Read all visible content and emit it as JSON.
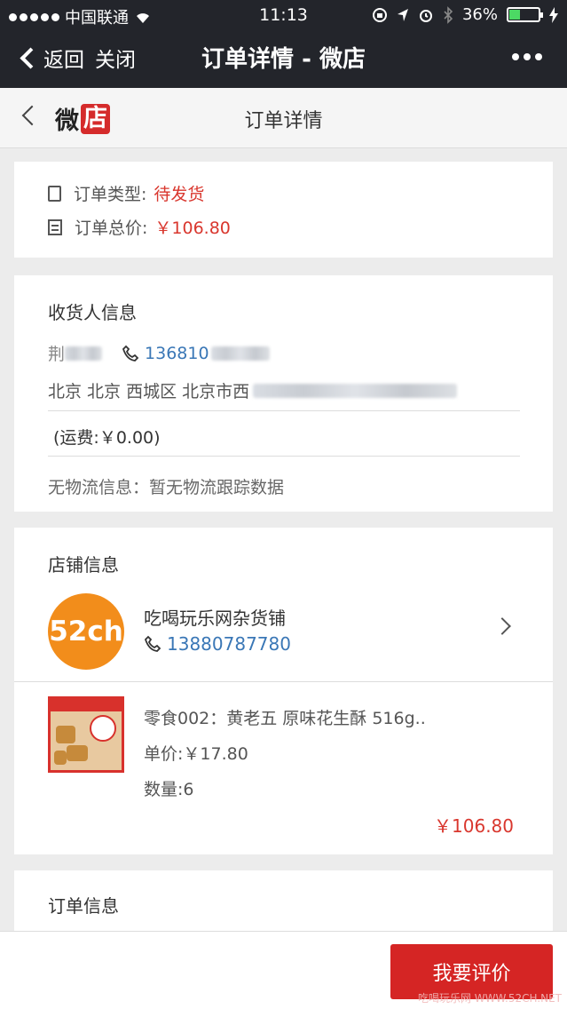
{
  "status_bar": {
    "carrier": "中国联通",
    "time": "11:13",
    "battery": "36%"
  },
  "nav": {
    "back_label": "返回",
    "close_label": "关闭",
    "title": "订单详情 - 微店"
  },
  "weidian_header": {
    "logo_char1": "微",
    "logo_char2": "店",
    "title": "订单详情"
  },
  "order_summary": {
    "type_label": "订单类型:",
    "type_value": "待发货",
    "total_label": "订单总价:",
    "total_value": "￥106.80"
  },
  "receiver": {
    "section_title": "收货人信息",
    "name": "荆",
    "phone": "136810",
    "address": "北京 北京 西城区 北京市西",
    "shipping_fee": "(运费:￥0.00)",
    "logistics": "无物流信息：暂无物流跟踪数据"
  },
  "store": {
    "section_title": "店铺信息",
    "logo_text": "52ch",
    "name": "吃喝玩乐网杂货铺",
    "phone": "13880787780"
  },
  "product": {
    "name": "零食002：黄老五 原味花生酥 516g..",
    "unit_price": "单价:￥17.80",
    "quantity": "数量:6",
    "total": "￥106.80"
  },
  "order_info": {
    "section_title": "订单信息"
  },
  "bottom": {
    "review_button": "我要评价",
    "watermark": "吃喝玩乐网 WWW.52CH.NET"
  },
  "colors": {
    "accent_red": "#d9372e",
    "link_blue": "#3a77b6",
    "nav_bg": "#23252b"
  }
}
